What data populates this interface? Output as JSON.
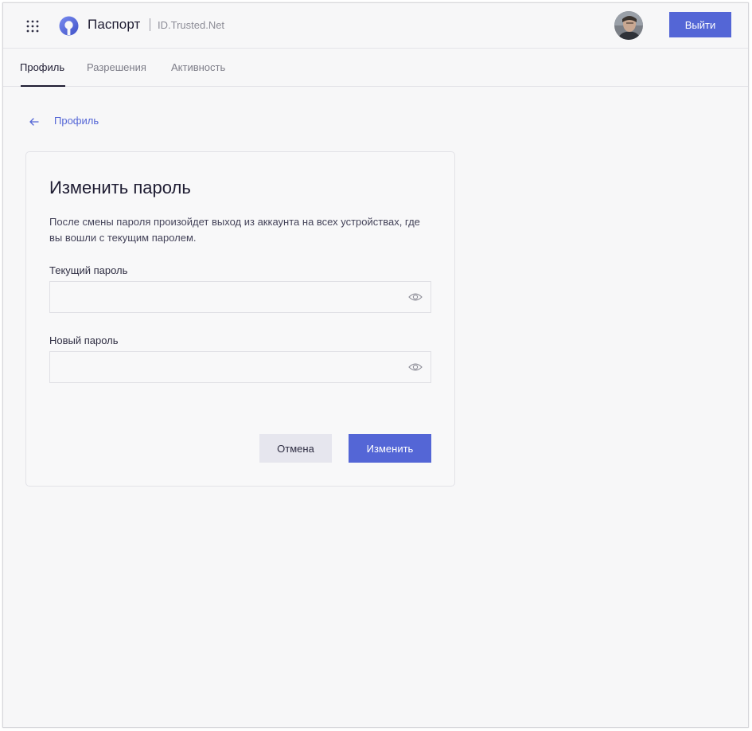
{
  "header": {
    "brand": "Паспорт",
    "brand_sub": "ID.Trusted.Net",
    "logout_label": "Выйти",
    "apps_icon": "grid-icon",
    "logo_icon": "passport-logo-icon",
    "accent_color": "#5466d6"
  },
  "tabs": [
    {
      "label": "Профиль",
      "active": true
    },
    {
      "label": "Разрешения",
      "active": false
    },
    {
      "label": "Активность",
      "active": false
    }
  ],
  "breadcrumb": {
    "icon": "arrow-left-icon",
    "label": "Профиль"
  },
  "card": {
    "title": "Изменить пароль",
    "description": "После смены пароля произойдет выход из аккаунта на всех устройствах, где вы вошли с текущим паролем.",
    "current_password": {
      "label": "Текущий пароль",
      "value": "",
      "placeholder": ""
    },
    "new_password": {
      "label": "Новый пароль",
      "value": "",
      "placeholder": ""
    },
    "cancel_label": "Отмена",
    "submit_label": "Изменить"
  }
}
